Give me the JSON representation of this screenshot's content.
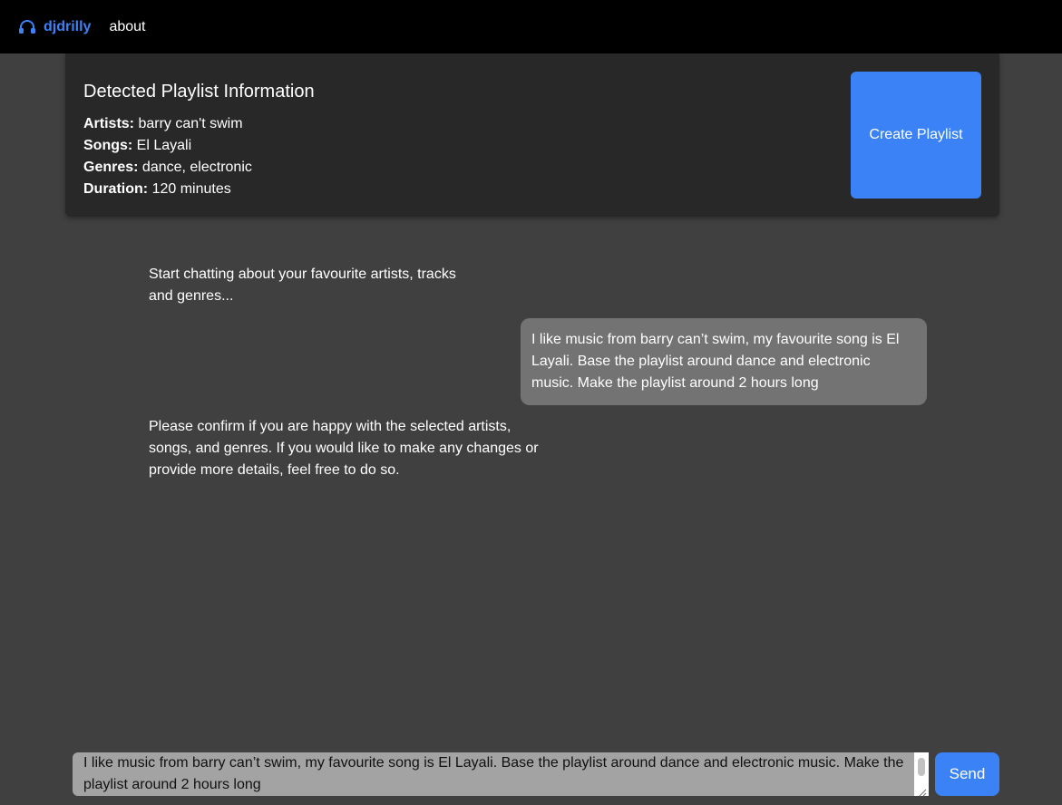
{
  "nav": {
    "brand_icon": "headphones-icon",
    "brand_label": "djdrilly",
    "about_label": "about"
  },
  "playlist_info": {
    "title": "Detected Playlist Information",
    "rows": [
      {
        "label": "Artists:",
        "value": "barry can't swim"
      },
      {
        "label": "Songs:",
        "value": "El Layali"
      },
      {
        "label": "Genres:",
        "value": "dance, electronic"
      },
      {
        "label": "Duration:",
        "value": "120 minutes"
      }
    ],
    "create_button_label": "Create Playlist"
  },
  "chat": {
    "messages": [
      {
        "role": "assistant",
        "text": "Start chatting about your favourite artists, tracks and genres..."
      },
      {
        "role": "user",
        "text": "I like music from barry can’t swim, my favourite song is El Layali. Base the playlist around dance and electronic music. Make the playlist around 2 hours long"
      },
      {
        "role": "assistant",
        "text": "Please confirm if you are happy with the selected artists, songs, and genres. If you would like to make any changes or provide more details, feel free to do so."
      }
    ]
  },
  "composer": {
    "value": "I like music from barry can’t swim, my favourite song is El Layali. Base the playlist around dance and electronic music. Make the playlist around 2 hours long",
    "send_label": "Send"
  },
  "colors": {
    "accent": "#3b82f6",
    "background": "#404040",
    "topbar": "#000000",
    "card": "#282828",
    "user_bubble": "#737373"
  }
}
